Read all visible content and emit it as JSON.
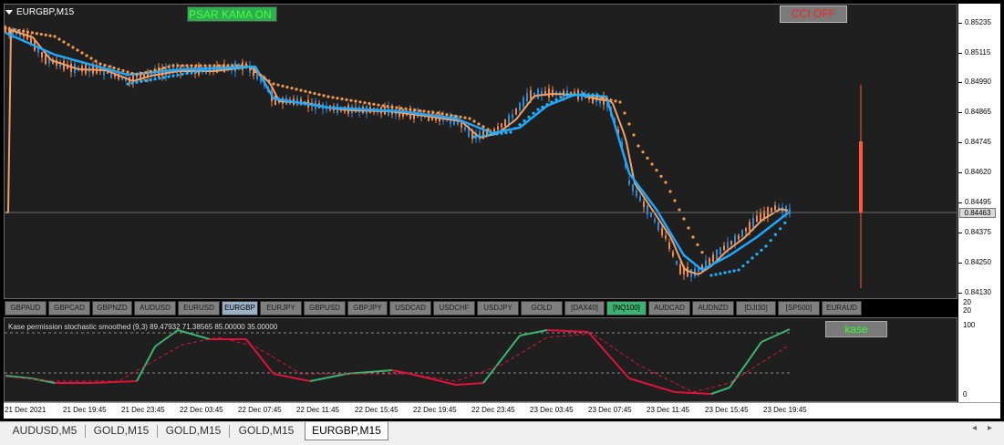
{
  "window": {
    "title": "EURGBP,M15"
  },
  "buttons": {
    "psar": "PSAR KAMA ON",
    "cci": "CCI OFF",
    "kase": "kase"
  },
  "symbols": [
    {
      "label": "GBPAUD"
    },
    {
      "label": "GBPCAD"
    },
    {
      "label": "GBPNZD"
    },
    {
      "label": "AUDUSD"
    },
    {
      "label": "EURUSD"
    },
    {
      "label": "EURGBP",
      "state": "active"
    },
    {
      "label": "EURJPY"
    },
    {
      "label": "GBPUSD"
    },
    {
      "label": "GBPJPY"
    },
    {
      "label": "USDCAD"
    },
    {
      "label": "USDCHF"
    },
    {
      "label": "USDJPY"
    },
    {
      "label": "GOLD"
    },
    {
      "label": "[DAX40]"
    },
    {
      "label": "[NQ100]",
      "state": "highlight"
    },
    {
      "label": "AUDCAD"
    },
    {
      "label": "AUDNZD"
    },
    {
      "label": "[DJI30]"
    },
    {
      "label": "[SP500]"
    },
    {
      "label": "EURAUD"
    }
  ],
  "price_axis": [
    "0.85235",
    "0.85115",
    "0.84990",
    "0.84865",
    "0.84745",
    "0.84620",
    "0.84495",
    "0.84375",
    "0.84250",
    "0.84130"
  ],
  "current_price": "0.84463",
  "gap_axis": {
    "top": "20",
    "bottom": "20"
  },
  "indicator": {
    "label": "Kase permission stochastic smoothed (9,3) 89.47932 71.38565 85.00000 35.00000",
    "axis": {
      "top": "100",
      "bottom": "0"
    }
  },
  "time_axis": [
    "21 Dec 2021",
    "21 Dec 19:45",
    "21 Dec 23:45",
    "22 Dec 03:45",
    "22 Dec 07:45",
    "22 Dec 11:45",
    "22 Dec 15:45",
    "22 Dec 19:45",
    "22 Dec 23:45",
    "23 Dec 03:45",
    "23 Dec 07:45",
    "23 Dec 11:45",
    "23 Dec 15:45",
    "23 Dec 19:45"
  ],
  "tabs": [
    {
      "label": "AUDUSD,M5"
    },
    {
      "label": "GOLD,M15"
    },
    {
      "label": "GOLD,M15"
    },
    {
      "label": "GOLD,M15"
    },
    {
      "label": "EURGBP,M15",
      "active": true
    }
  ],
  "colors": {
    "bull_candle": "#2f8ad8",
    "bear_candle": "#f0894a",
    "kama": "#f0a068",
    "kama_fast": "#1ea7ff",
    "psar_orange": "#f09a50",
    "psar_blue": "#1eb4ff",
    "stoch_up": "#3cb371",
    "stoch_down": "#dc143c",
    "cci_bar": "#ff5a3c"
  }
}
